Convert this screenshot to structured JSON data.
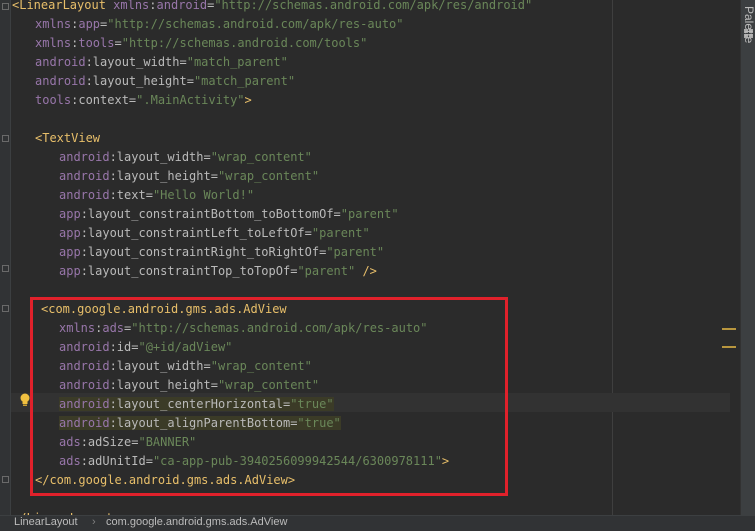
{
  "editor": {
    "lines": [
      [
        [
          "tag",
          "<LinearLayout "
        ],
        [
          "ns",
          "xmlns"
        ],
        [
          "attr",
          ":"
        ],
        [
          "ns",
          "android"
        ],
        [
          "attr",
          "="
        ],
        [
          "val",
          "\"http://schemas.android.com/apk/res/android\""
        ]
      ],
      [
        [
          "ns",
          "xmlns"
        ],
        [
          "attr",
          ":"
        ],
        [
          "ns",
          "app"
        ],
        [
          "attr",
          "="
        ],
        [
          "val",
          "\"http://schemas.android.com/apk/res-auto\""
        ]
      ],
      [
        [
          "ns",
          "xmlns"
        ],
        [
          "attr",
          ":"
        ],
        [
          "ns",
          "tools"
        ],
        [
          "attr",
          "="
        ],
        [
          "val",
          "\"http://schemas.android.com/tools\""
        ]
      ],
      [
        [
          "ns",
          "android"
        ],
        [
          "attr",
          ":layout_width="
        ],
        [
          "val",
          "\"match_parent\""
        ]
      ],
      [
        [
          "ns",
          "android"
        ],
        [
          "attr",
          ":layout_height="
        ],
        [
          "val",
          "\"match_parent\""
        ]
      ],
      [
        [
          "ns",
          "tools"
        ],
        [
          "attr",
          ":context="
        ],
        [
          "val",
          "\".MainActivity\""
        ],
        [
          "tag",
          ">"
        ]
      ],
      [],
      [
        [
          "tag",
          "<TextView"
        ]
      ],
      [
        [
          "ns",
          "android"
        ],
        [
          "attr",
          ":layout_width="
        ],
        [
          "val",
          "\"wrap_content\""
        ]
      ],
      [
        [
          "ns",
          "android"
        ],
        [
          "attr",
          ":layout_height="
        ],
        [
          "val",
          "\"wrap_content\""
        ]
      ],
      [
        [
          "ns",
          "android"
        ],
        [
          "attr",
          ":text="
        ],
        [
          "val",
          "\"Hello World!\""
        ]
      ],
      [
        [
          "ns",
          "app"
        ],
        [
          "attr",
          ":layout_constraintBottom_toBottomOf="
        ],
        [
          "val",
          "\"parent\""
        ]
      ],
      [
        [
          "ns",
          "app"
        ],
        [
          "attr",
          ":layout_constraintLeft_toLeftOf="
        ],
        [
          "val",
          "\"parent\""
        ]
      ],
      [
        [
          "ns",
          "app"
        ],
        [
          "attr",
          ":layout_constraintRight_toRightOf="
        ],
        [
          "val",
          "\"parent\""
        ]
      ],
      [
        [
          "ns",
          "app"
        ],
        [
          "attr",
          ":layout_constraintTop_toTopOf="
        ],
        [
          "val",
          "\"parent\""
        ],
        [
          "tag",
          " />"
        ]
      ],
      [],
      [
        [
          "tag",
          "<com.google.android.gms.ads.AdView"
        ]
      ],
      [
        [
          "ns",
          "xmlns"
        ],
        [
          "attr",
          ":"
        ],
        [
          "ns",
          "ads"
        ],
        [
          "attr",
          "="
        ],
        [
          "val",
          "\"http://schemas.android.com/apk/res-auto\""
        ]
      ],
      [
        [
          "ns",
          "android"
        ],
        [
          "attr",
          ":id="
        ],
        [
          "val",
          "\"@+id/adView\""
        ]
      ],
      [
        [
          "ns",
          "android"
        ],
        [
          "attr",
          ":layout_width="
        ],
        [
          "val",
          "\"wrap_content\""
        ]
      ],
      [
        [
          "ns",
          "android"
        ],
        [
          "attr",
          ":layout_height="
        ],
        [
          "val",
          "\"wrap_content\""
        ]
      ],
      [
        [
          "ns",
          "android"
        ],
        [
          "attr",
          ":layout_centerHorizontal="
        ],
        [
          "val",
          "\"true\""
        ]
      ],
      [
        [
          "ns",
          "android"
        ],
        [
          "attr",
          ":layout_alignParentBottom="
        ],
        [
          "val",
          "\"true\""
        ]
      ],
      [
        [
          "ns",
          "ads"
        ],
        [
          "attr",
          ":adSize="
        ],
        [
          "val",
          "\"BANNER\""
        ]
      ],
      [
        [
          "ns",
          "ads"
        ],
        [
          "attr",
          ":adUnitId="
        ],
        [
          "val",
          "\"ca-app-pub-3940256099942544/6300978111\""
        ],
        [
          "tag",
          ">"
        ]
      ],
      [
        [
          "tag",
          "</com.google.android.gms.ads.AdView>"
        ]
      ],
      [],
      [
        [
          "tag",
          "</LinearLayout>"
        ]
      ]
    ]
  },
  "side_panel": {
    "label": "Palette",
    "icon": "palette-icon"
  },
  "breadcrumb": {
    "items": [
      "LinearLayout",
      "com.google.android.gms.ads.AdView"
    ],
    "separator": "›"
  },
  "colors": {
    "background": "#2b2b2b",
    "tag": "#e8bf6a",
    "namespace": "#9876aa",
    "attribute": "#bababa",
    "value": "#6a8759",
    "selection_box": "#e0212b",
    "warning_bulb": "#f0c040"
  }
}
